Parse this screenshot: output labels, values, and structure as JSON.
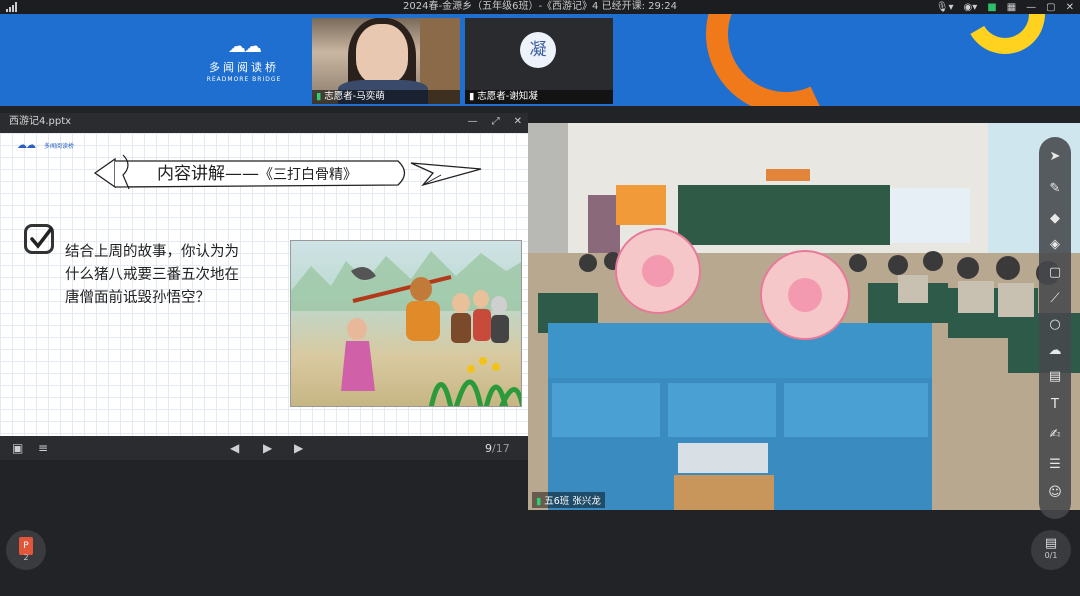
{
  "topbar": {
    "title": "2024春-金源乡（五年级6班）-《西游记》4   已经开课: 29:24",
    "tray": [
      "mic-icon ▾",
      "location-icon ▾",
      "camera-icon",
      "grid-icon",
      "—",
      "□",
      "✕"
    ]
  },
  "banner": {
    "logo_cn": "多闻阅读桥",
    "logo_en": "READMORE BRIDGE"
  },
  "participants": [
    {
      "name": "志愿者-马奕萌",
      "has_video": true
    },
    {
      "name": "志愿者-谢知凝",
      "avatar_char": "凝",
      "has_video": false
    }
  ],
  "ppt_window": {
    "filename": "西游记4.pptx",
    "heading": "内容讲解——",
    "heading_sub": "《三打白骨精》",
    "question_lines": [
      "结合上周的故事，你认为为",
      "什么猪八戒要三番五次地在",
      "唐僧面前诋毁孙悟空？"
    ],
    "page_current": "9",
    "page_total": "/17"
  },
  "classroom": {
    "caption": "五6班  张兴龙"
  },
  "dock": {
    "ppt_count": "2",
    "page_count": "0/1"
  },
  "colors": {
    "banner": "#1f6fd0",
    "orange": "#f07a1a",
    "yellow": "#ffd21f",
    "mic_green": "#2fd070"
  },
  "icons": [
    "signal-icon",
    "mic-icon",
    "location-icon",
    "camera-icon",
    "grid-icon",
    "minimize-icon",
    "maximize-icon",
    "close-icon",
    "checkbox-icon",
    "toc-icon",
    "prev-slide-icon",
    "play-icon",
    "next-slide-icon",
    "cursor-icon",
    "pen-icon",
    "eraser-icon",
    "fill-icon",
    "shape-icon",
    "text-icon",
    "cloud-icon",
    "box-icon",
    "users-icon",
    "chat-icon",
    "edit-icon",
    "upload-icon"
  ]
}
